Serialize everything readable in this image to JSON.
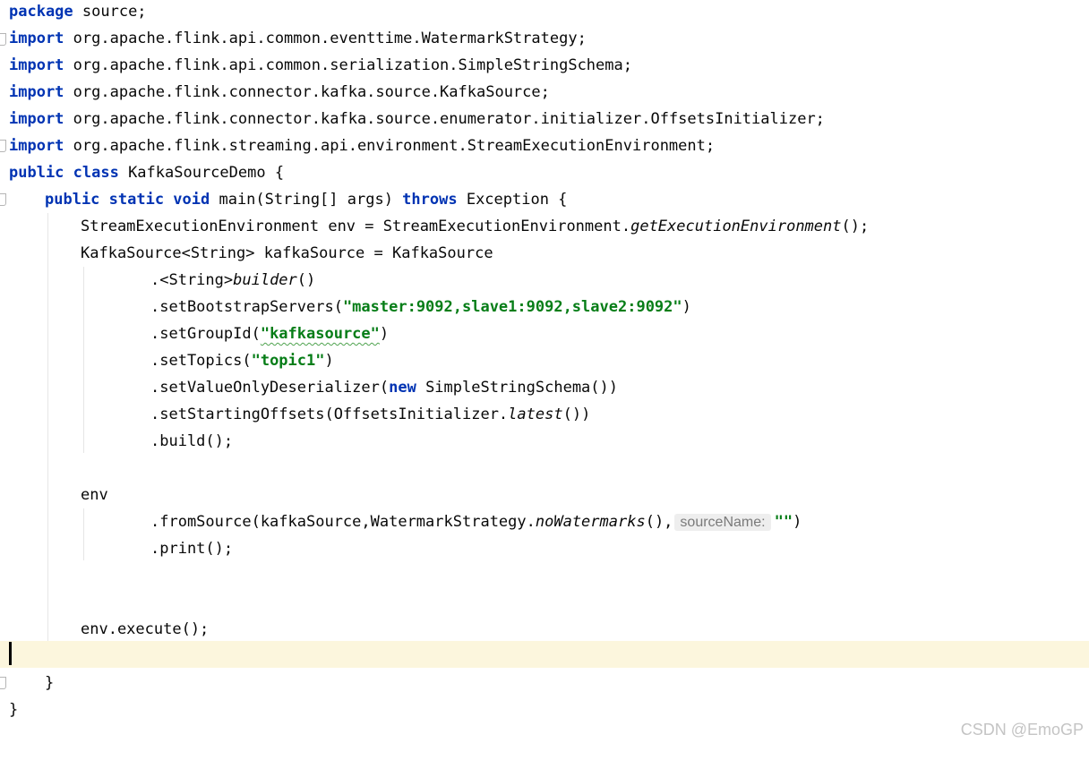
{
  "lines": {
    "l1": {
      "kw": "package",
      "rest": " source;"
    },
    "l2": {
      "kw": "import",
      "rest": " org.apache.flink.api.common.eventtime.WatermarkStrategy;"
    },
    "l3": {
      "kw": "import",
      "rest": " org.apache.flink.api.common.serialization.SimpleStringSchema;"
    },
    "l4": {
      "kw": "import",
      "rest": " org.apache.flink.connector.kafka.source.KafkaSource;"
    },
    "l5": {
      "kw": "import",
      "rest": " org.apache.flink.connector.kafka.source.enumerator.initializer.OffsetsInitializer;"
    },
    "l6": {
      "kw": "import",
      "rest": " org.apache.flink.streaming.api.environment.StreamExecutionEnvironment;"
    },
    "l7": {
      "kw": "public class",
      "rest": " KafkaSourceDemo {"
    },
    "l8": {
      "kw": "public static void",
      "mid": " main(String[] args) ",
      "kw2": "throws",
      "rest": " Exception {"
    },
    "l9": {
      "a": "StreamExecutionEnvironment env = StreamExecutionEnvironment.",
      "it": "getExecutionEnvironment",
      "b": "();"
    },
    "l10": {
      "text": "KafkaSource<String> kafkaSource = KafkaSource"
    },
    "l11": {
      "a": ".<String>",
      "it": "builder",
      "b": "()"
    },
    "l12": {
      "a": ".setBootstrapServers(",
      "str": "\"master:9092,slave1:9092,slave2:9092\"",
      "b": ")"
    },
    "l13": {
      "a": ".setGroupId(",
      "str": "\"kafkasource\"",
      "b": ")"
    },
    "l14": {
      "a": ".setTopics(",
      "str": "\"topic1\"",
      "b": ")"
    },
    "l15": {
      "a": ".setValueOnlyDeserializer(",
      "kw": "new",
      "b": " SimpleStringSchema())"
    },
    "l16": {
      "a": ".setStartingOffsets(OffsetsInitializer.",
      "it": "latest",
      "b": "())"
    },
    "l17": {
      "text": ".build();"
    },
    "l19": {
      "text": "env"
    },
    "l20": {
      "a": ".fromSource(kafkaSource,WatermarkStrategy.",
      "it": "noWatermarks",
      "b": "(),",
      "hint": "sourceName:",
      "str": "\"\"",
      "c": ")"
    },
    "l21": {
      "text": ".print();"
    },
    "l24": {
      "text": "env.execute();"
    },
    "l26": {
      "text": "}"
    },
    "l27": {
      "text": "}"
    }
  },
  "watermark": "CSDN @EmoGP"
}
